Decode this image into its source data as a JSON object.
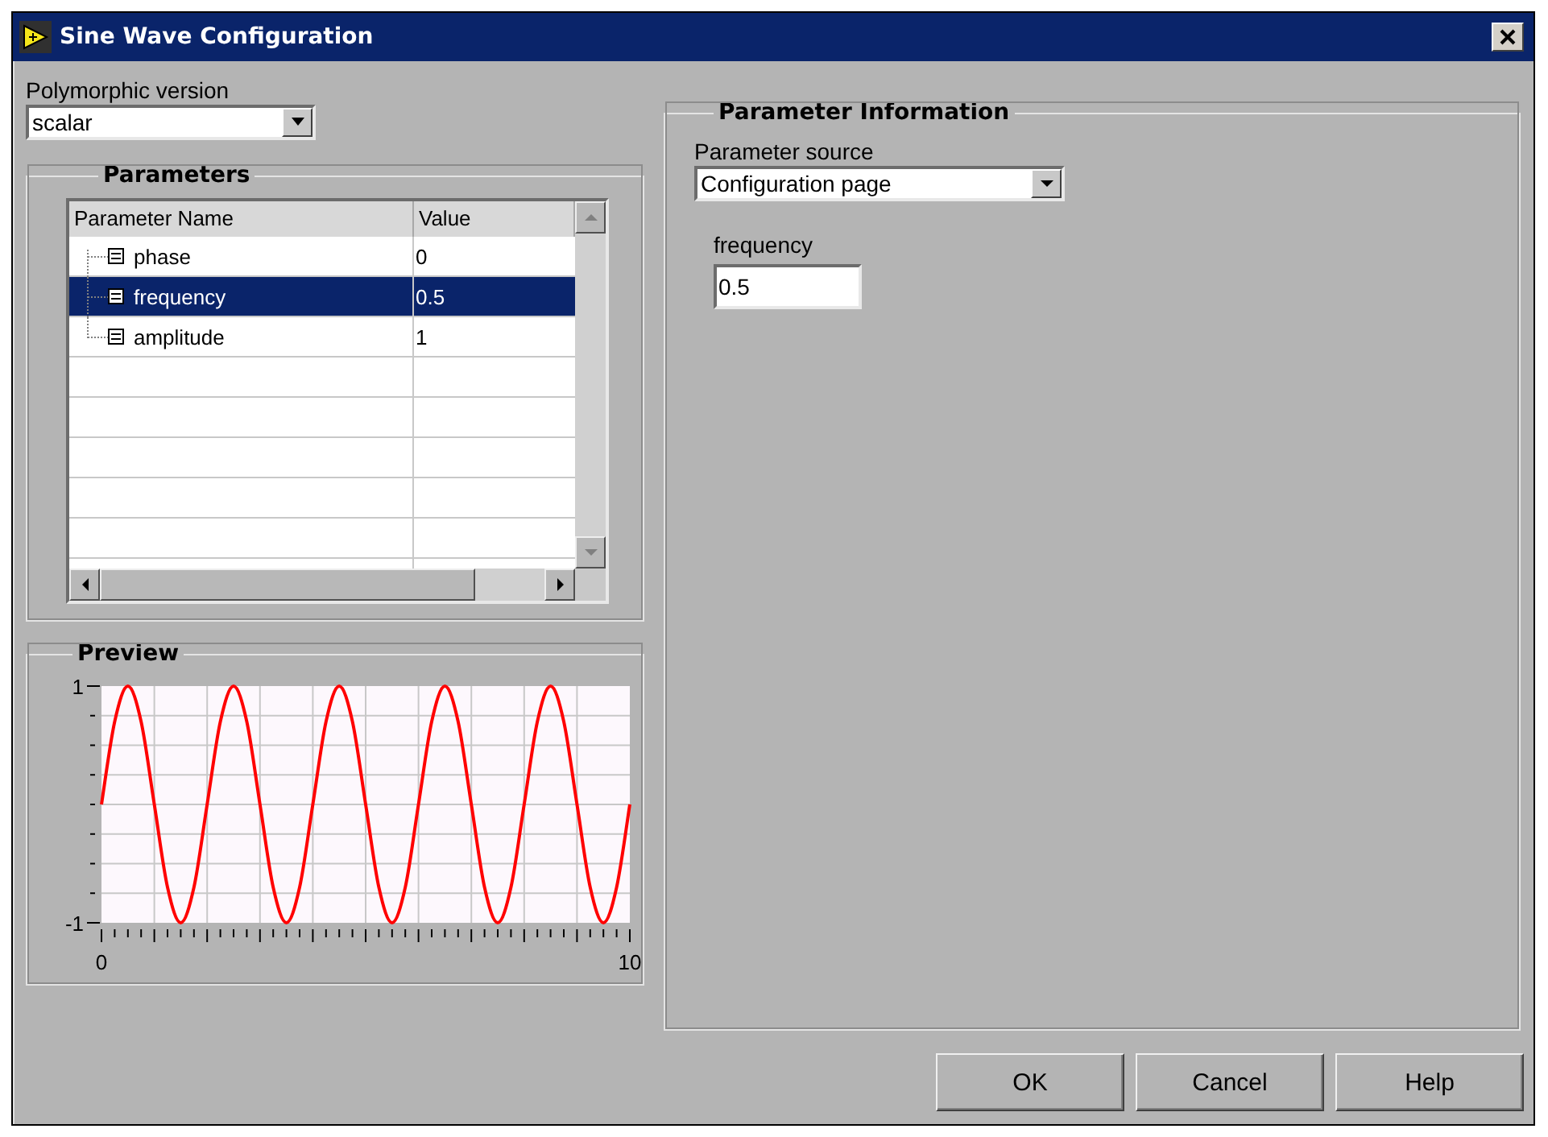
{
  "window": {
    "title": "Sine Wave Configuration"
  },
  "polymorphic_version": {
    "label": "Polymorphic version",
    "value": "scalar"
  },
  "parameters": {
    "title": "Parameters",
    "columns": [
      "Parameter Name",
      "Value"
    ],
    "rows": [
      {
        "name": "phase",
        "value": "0",
        "selected": false
      },
      {
        "name": "frequency",
        "value": "0.5",
        "selected": true
      },
      {
        "name": "amplitude",
        "value": "1",
        "selected": false
      }
    ]
  },
  "preview": {
    "title": "Preview",
    "chart_data": {
      "type": "line",
      "x": [
        0,
        0.25,
        0.5,
        0.75,
        1,
        1.25,
        1.5,
        1.75,
        2,
        2.25,
        2.5,
        2.75,
        3,
        3.25,
        3.5,
        3.75,
        4,
        4.25,
        4.5,
        4.75,
        5,
        5.25,
        5.5,
        5.75,
        6,
        6.25,
        6.5,
        6.75,
        7,
        7.25,
        7.5,
        7.75,
        8,
        8.25,
        8.5,
        8.75,
        9,
        9.25,
        9.5,
        9.75,
        10
      ],
      "series": [
        {
          "color": "#ff0000",
          "values": [
            0,
            0.7,
            1,
            0.7,
            0,
            -0.7,
            -1,
            -0.7,
            0,
            0.7,
            1,
            0.7,
            0,
            -0.7,
            -1,
            -0.7,
            0,
            0.7,
            1,
            0.7,
            0,
            -0.7,
            -1,
            -0.7,
            0,
            0.7,
            1,
            0.7,
            0,
            -0.7,
            -1,
            -0.7,
            0,
            0.7,
            1,
            0.7,
            0,
            -0.7,
            -1,
            -0.7,
            0
          ]
        }
      ],
      "xlim": [
        0,
        10
      ],
      "ylim": [
        -1,
        1
      ],
      "xticks": [
        0,
        10
      ],
      "yticks": [
        -1,
        1
      ]
    }
  },
  "parameter_information": {
    "title": "Parameter Information",
    "source": {
      "label": "Parameter source",
      "value": "Configuration page"
    },
    "field": {
      "label": "frequency",
      "value": "0.5"
    }
  },
  "buttons": [
    "OK",
    "Cancel",
    "Help"
  ]
}
